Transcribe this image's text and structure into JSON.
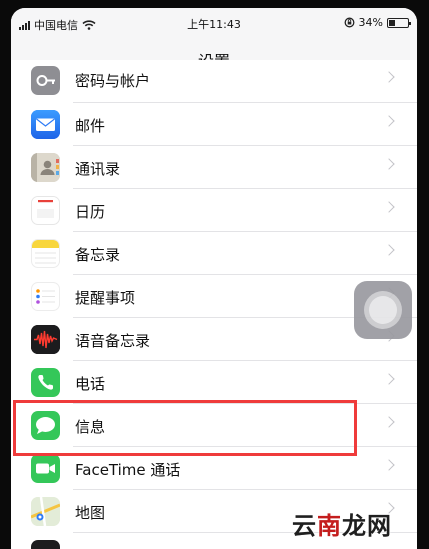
{
  "status_bar": {
    "carrier": "中国电信",
    "time": "上午11:43",
    "battery_percent": "34%",
    "battery_level": 0.34
  },
  "nav": {
    "title": "设置"
  },
  "rows": [
    {
      "label": "密码与帐户",
      "icon": "key-icon",
      "partial": true
    },
    {
      "label": "邮件",
      "icon": "mail-icon"
    },
    {
      "label": "通讯录",
      "icon": "contacts-icon"
    },
    {
      "label": "日历",
      "icon": "calendar-icon"
    },
    {
      "label": "备忘录",
      "icon": "notes-icon"
    },
    {
      "label": "提醒事项",
      "icon": "reminders-icon"
    },
    {
      "label": "语音备忘录",
      "icon": "voice-memos-icon"
    },
    {
      "label": "电话",
      "icon": "phone-icon"
    },
    {
      "label": "信息",
      "icon": "messages-icon",
      "highlighted": true
    },
    {
      "label": "FaceTime 通话",
      "icon": "facetime-icon"
    },
    {
      "label": "地图",
      "icon": "maps-icon"
    }
  ],
  "watermark": {
    "text_left": "云",
    "text_mid": "南",
    "text_right": "龙网"
  },
  "colors": {
    "highlight_border": "#ef3b3b",
    "mail": "#2f7cf6",
    "phone": "#34c759",
    "messages": "#34c759",
    "facetime": "#34c759",
    "voice_memos": "#1c1c1e"
  }
}
